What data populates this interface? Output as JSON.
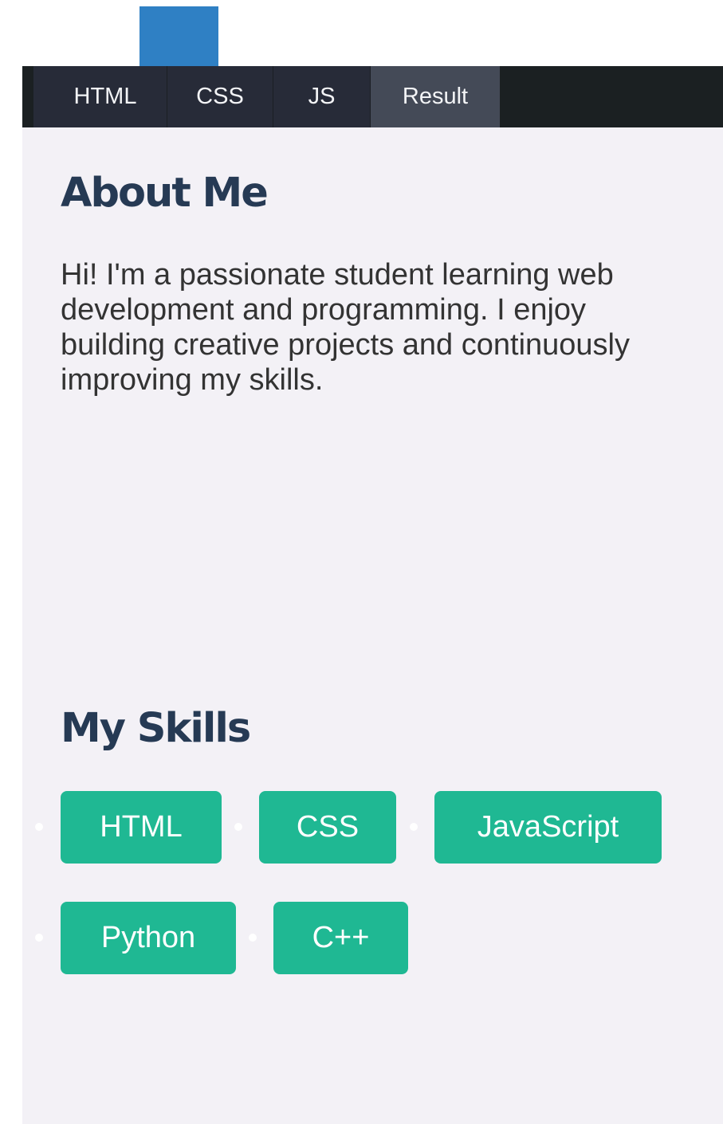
{
  "tabs": [
    {
      "label": "HTML",
      "active": false
    },
    {
      "label": "CSS",
      "active": false
    },
    {
      "label": "JS",
      "active": false
    },
    {
      "label": "Result",
      "active": true
    }
  ],
  "about": {
    "heading": "About Me",
    "text": "Hi! I'm a passionate student learning web development and programming. I enjoy building creative projects and continuously improving my skills."
  },
  "skills": {
    "heading": "My Skills",
    "items": [
      "HTML",
      "CSS",
      "JavaScript",
      "Python",
      "C++"
    ]
  },
  "colors": {
    "tab_bar": "#1b2022",
    "tab": "#272b38",
    "tab_active": "#444a57",
    "heading": "#263a54",
    "skill_chip": "#1fb893",
    "background": "#f3f1f6",
    "blue_block": "#2f80c4"
  }
}
